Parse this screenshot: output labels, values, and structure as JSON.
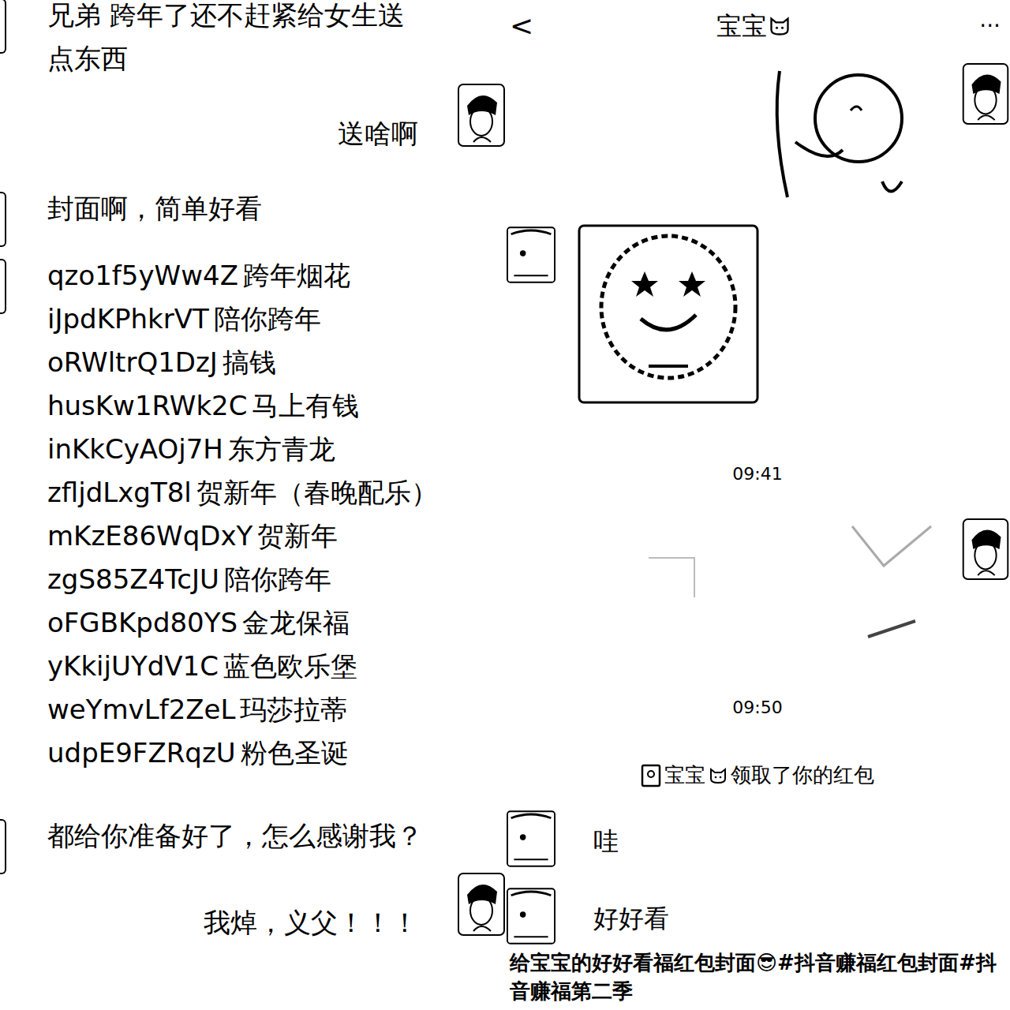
{
  "left_chat": {
    "messages": [
      {
        "side": "left",
        "kind": "text",
        "lines": [
          "兄弟 跨年了还不赶紧给女生送",
          "点东西"
        ]
      },
      {
        "side": "right",
        "kind": "text",
        "lines": [
          "送啥啊"
        ]
      },
      {
        "side": "left",
        "kind": "text",
        "lines": [
          "封面啊，简单好看"
        ]
      },
      {
        "side": "left",
        "kind": "list",
        "items": [
          {
            "code": "qzo1f5yWw4Z",
            "label": "跨年烟花"
          },
          {
            "code": "iJpdKPhkrVT",
            "label": "陪你跨年"
          },
          {
            "code": "oRWltrQ1DzJ",
            "label": "搞钱"
          },
          {
            "code": "husKw1RWk2C",
            "label": "马上有钱"
          },
          {
            "code": "inKkCyAOj7H",
            "label": "东方青龙"
          },
          {
            "code": "zfljdLxgT8l",
            "label": "贺新年（春晚配乐）"
          },
          {
            "code": "mKzE86WqDxY",
            "label": "贺新年"
          },
          {
            "code": "zgS85Z4TcJU",
            "label": "陪你跨年"
          },
          {
            "code": "oFGBKpd80YS",
            "label": "金龙保福"
          },
          {
            "code": "yKkijUYdV1C",
            "label": "蓝色欧乐堡"
          },
          {
            "code": "weYmvLf2ZeL",
            "label": "玛莎拉蒂"
          },
          {
            "code": "udpE9FZRqzU",
            "label": "粉色圣诞"
          }
        ]
      },
      {
        "side": "left",
        "kind": "text",
        "lines": [
          "都给你准备好了，怎么感谢我？"
        ]
      },
      {
        "side": "right",
        "kind": "text",
        "lines": [
          "我焯，义父！！！"
        ]
      }
    ]
  },
  "wechat": {
    "header": {
      "back": "<",
      "title": "宝宝",
      "menu": "···"
    },
    "messages": [
      {
        "side": "right",
        "kind": "sticker"
      },
      {
        "side": "left",
        "kind": "sticker"
      },
      {
        "kind": "time",
        "text": "09:41"
      },
      {
        "side": "right",
        "kind": "redpacket"
      },
      {
        "kind": "time",
        "text": "09:50"
      },
      {
        "kind": "system",
        "name": "宝宝",
        "text": "领取了你的红包"
      },
      {
        "side": "left",
        "kind": "text",
        "text": "哇"
      },
      {
        "side": "left",
        "kind": "text",
        "text": "好好看"
      }
    ],
    "caption": "给宝宝的好好看福红包封面😎#抖音赚福红包封面#抖音赚福第二季"
  }
}
